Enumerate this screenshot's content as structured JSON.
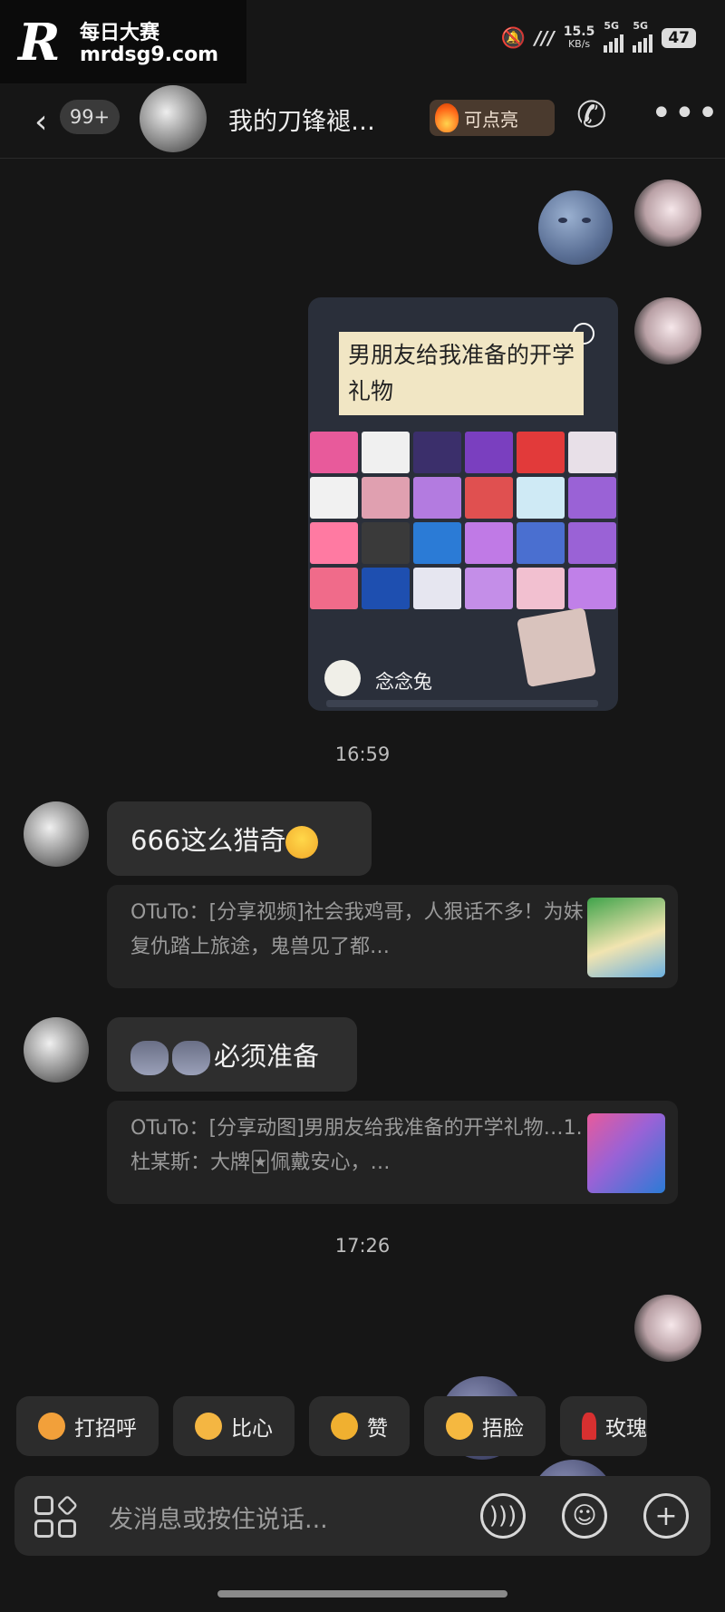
{
  "watermark": {
    "logo": "R",
    "site_name": "每日大赛",
    "url": "mrdsg9.com"
  },
  "status_bar": {
    "speed_value": "15.5",
    "speed_unit": "KB/s",
    "signal_1": "5G",
    "signal_2": "5G",
    "battery": "47"
  },
  "header": {
    "back_label": "‹",
    "unread_badge": "99+",
    "title": "我的刀锋褪…",
    "spark_label": "可点亮",
    "more_label": "•••"
  },
  "card": {
    "note_text": "男朋友给我准备的开学礼物",
    "author": "念念兔",
    "box_colors": [
      "#e85a9b",
      "#f0f0f0",
      "#3b2f6b",
      "#7a3fbf",
      "#e23a3a",
      "#e8e0e8",
      "#f1f1f1",
      "#e0a0b0",
      "#b37be0",
      "#e05050",
      "#cfeaf5",
      "#9a62d6",
      "#ff7aa2",
      "#3a3a3a",
      "#2b7bd6",
      "#c07ae6",
      "#4a6fd0",
      "#9a62d6",
      "#f06b8a",
      "#1e4fb0",
      "#e6e6f0",
      "#c48ee8",
      "#f2c0d0",
      "#c080e8"
    ]
  },
  "messages": {
    "time_1": "16:59",
    "msg1": "666这么猎奇",
    "quote1": "OTuTo：[分享视频]社会我鸡哥，人狠话不多！为妹复仇踏上旅途，鬼兽见了都…",
    "msg2": "必须准备",
    "quote2": "OTuTo：[分享动图]男朋友给我准备的开学礼物…1.杜某斯：大牌🃏佩戴安心，…",
    "time_2": "17:26"
  },
  "quick_replies": [
    {
      "label": "打招呼",
      "color": "#f2a03a"
    },
    {
      "label": "比心",
      "color": "#f4b642"
    },
    {
      "label": "赞",
      "color": "#f0b030"
    },
    {
      "label": "捂脸",
      "color": "#f5b840"
    },
    {
      "label": "玫瑰",
      "color": "#d83030"
    }
  ],
  "input": {
    "placeholder": "发消息或按住说话..."
  }
}
